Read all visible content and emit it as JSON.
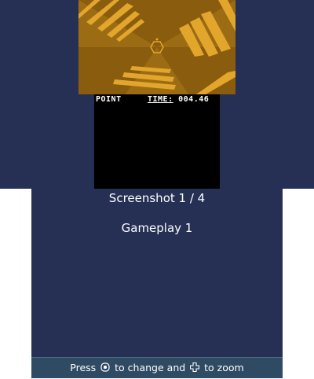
{
  "game": {
    "hud_point_label": "POINT",
    "hud_time_label": "TIME:",
    "hud_time_value": "004.46"
  },
  "viewer": {
    "screenshot_counter": "Screenshot 1 / 4",
    "caption": "Gameplay 1"
  },
  "footer": {
    "press": "Press",
    "to_change_and": "to change and",
    "to_zoom": "to zoom",
    "change_icon": "circle-pad-icon",
    "zoom_icon": "dpad-icon"
  },
  "colors": {
    "background": "#263055",
    "game_dark": "#8a5c0d",
    "game_stripe": "#e3a62c",
    "footer_bar": "#2f4a63"
  }
}
